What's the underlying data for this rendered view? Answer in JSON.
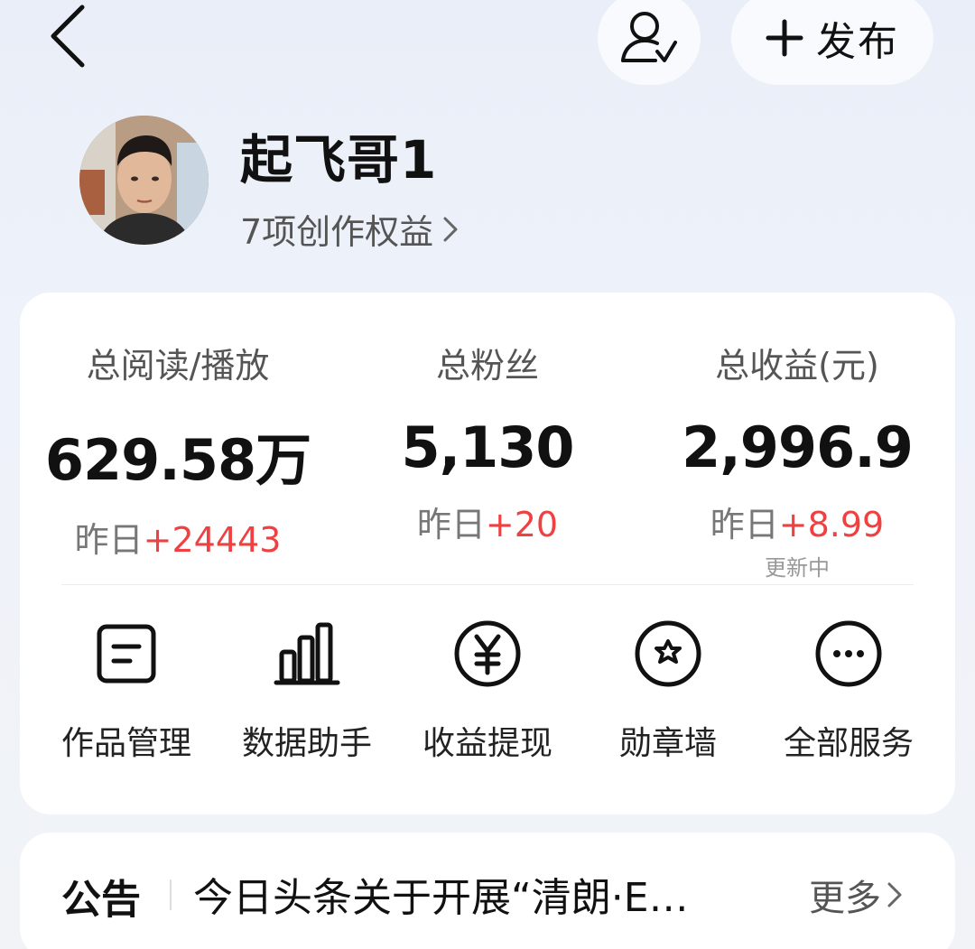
{
  "header": {
    "publish_label": "发布"
  },
  "profile": {
    "username": "起飞哥1",
    "rights_link": "7项创作权益"
  },
  "stats": [
    {
      "label": "总阅读/播放",
      "value": "629.58万",
      "delta_prefix": "昨日",
      "delta": "+24443",
      "note": ""
    },
    {
      "label": "总粉丝",
      "value": "5,130",
      "delta_prefix": "昨日",
      "delta": "+20",
      "note": ""
    },
    {
      "label": "总收益(元)",
      "value": "2,996.9",
      "delta_prefix": "昨日",
      "delta": "+8.99",
      "note": "更新中"
    }
  ],
  "services": [
    {
      "label": "作品管理",
      "icon": "document-icon"
    },
    {
      "label": "数据助手",
      "icon": "bar-chart-icon"
    },
    {
      "label": "收益提现",
      "icon": "yuan-icon"
    },
    {
      "label": "勋章墙",
      "icon": "medal-icon"
    },
    {
      "label": "全部服务",
      "icon": "more-icon"
    }
  ],
  "notice": {
    "title": "公告",
    "text": "今日头条关于开展“清朗·E…",
    "more_label": "更多"
  },
  "colors": {
    "accent_red": "#f04142",
    "background": "#eef2fa",
    "card": "#ffffff"
  }
}
